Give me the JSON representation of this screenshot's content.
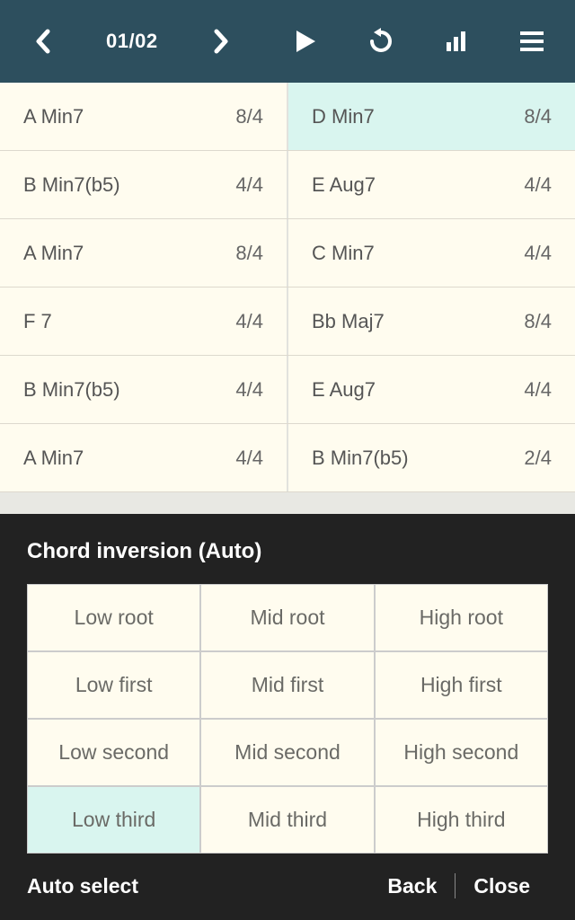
{
  "header": {
    "page_label": "01/02"
  },
  "chords": [
    [
      {
        "name": "A Min7",
        "sig": "8/4",
        "hl": false
      },
      {
        "name": "D Min7",
        "sig": "8/4",
        "hl": true
      }
    ],
    [
      {
        "name": "B Min7(b5)",
        "sig": "4/4",
        "hl": false
      },
      {
        "name": "E Aug7",
        "sig": "4/4",
        "hl": false
      }
    ],
    [
      {
        "name": "A Min7",
        "sig": "8/4",
        "hl": false
      },
      {
        "name": "C Min7",
        "sig": "4/4",
        "hl": false
      }
    ],
    [
      {
        "name": "F 7",
        "sig": "4/4",
        "hl": false
      },
      {
        "name": "Bb Maj7",
        "sig": "8/4",
        "hl": false
      }
    ],
    [
      {
        "name": "B Min7(b5)",
        "sig": "4/4",
        "hl": false
      },
      {
        "name": "E Aug7",
        "sig": "4/4",
        "hl": false
      }
    ],
    [
      {
        "name": "A Min7",
        "sig": "4/4",
        "hl": false
      },
      {
        "name": "B Min7(b5)",
        "sig": "2/4",
        "hl": false
      }
    ]
  ],
  "panel": {
    "title": "Chord inversion (Auto)",
    "options": [
      [
        "Low root",
        "Mid root",
        "High root"
      ],
      [
        "Low first",
        "Mid first",
        "High first"
      ],
      [
        "Low second",
        "Mid second",
        "High second"
      ],
      [
        "Low third",
        "Mid third",
        "High third"
      ]
    ],
    "selected": "Low third",
    "auto_label": "Auto select",
    "back_label": "Back",
    "close_label": "Close"
  }
}
